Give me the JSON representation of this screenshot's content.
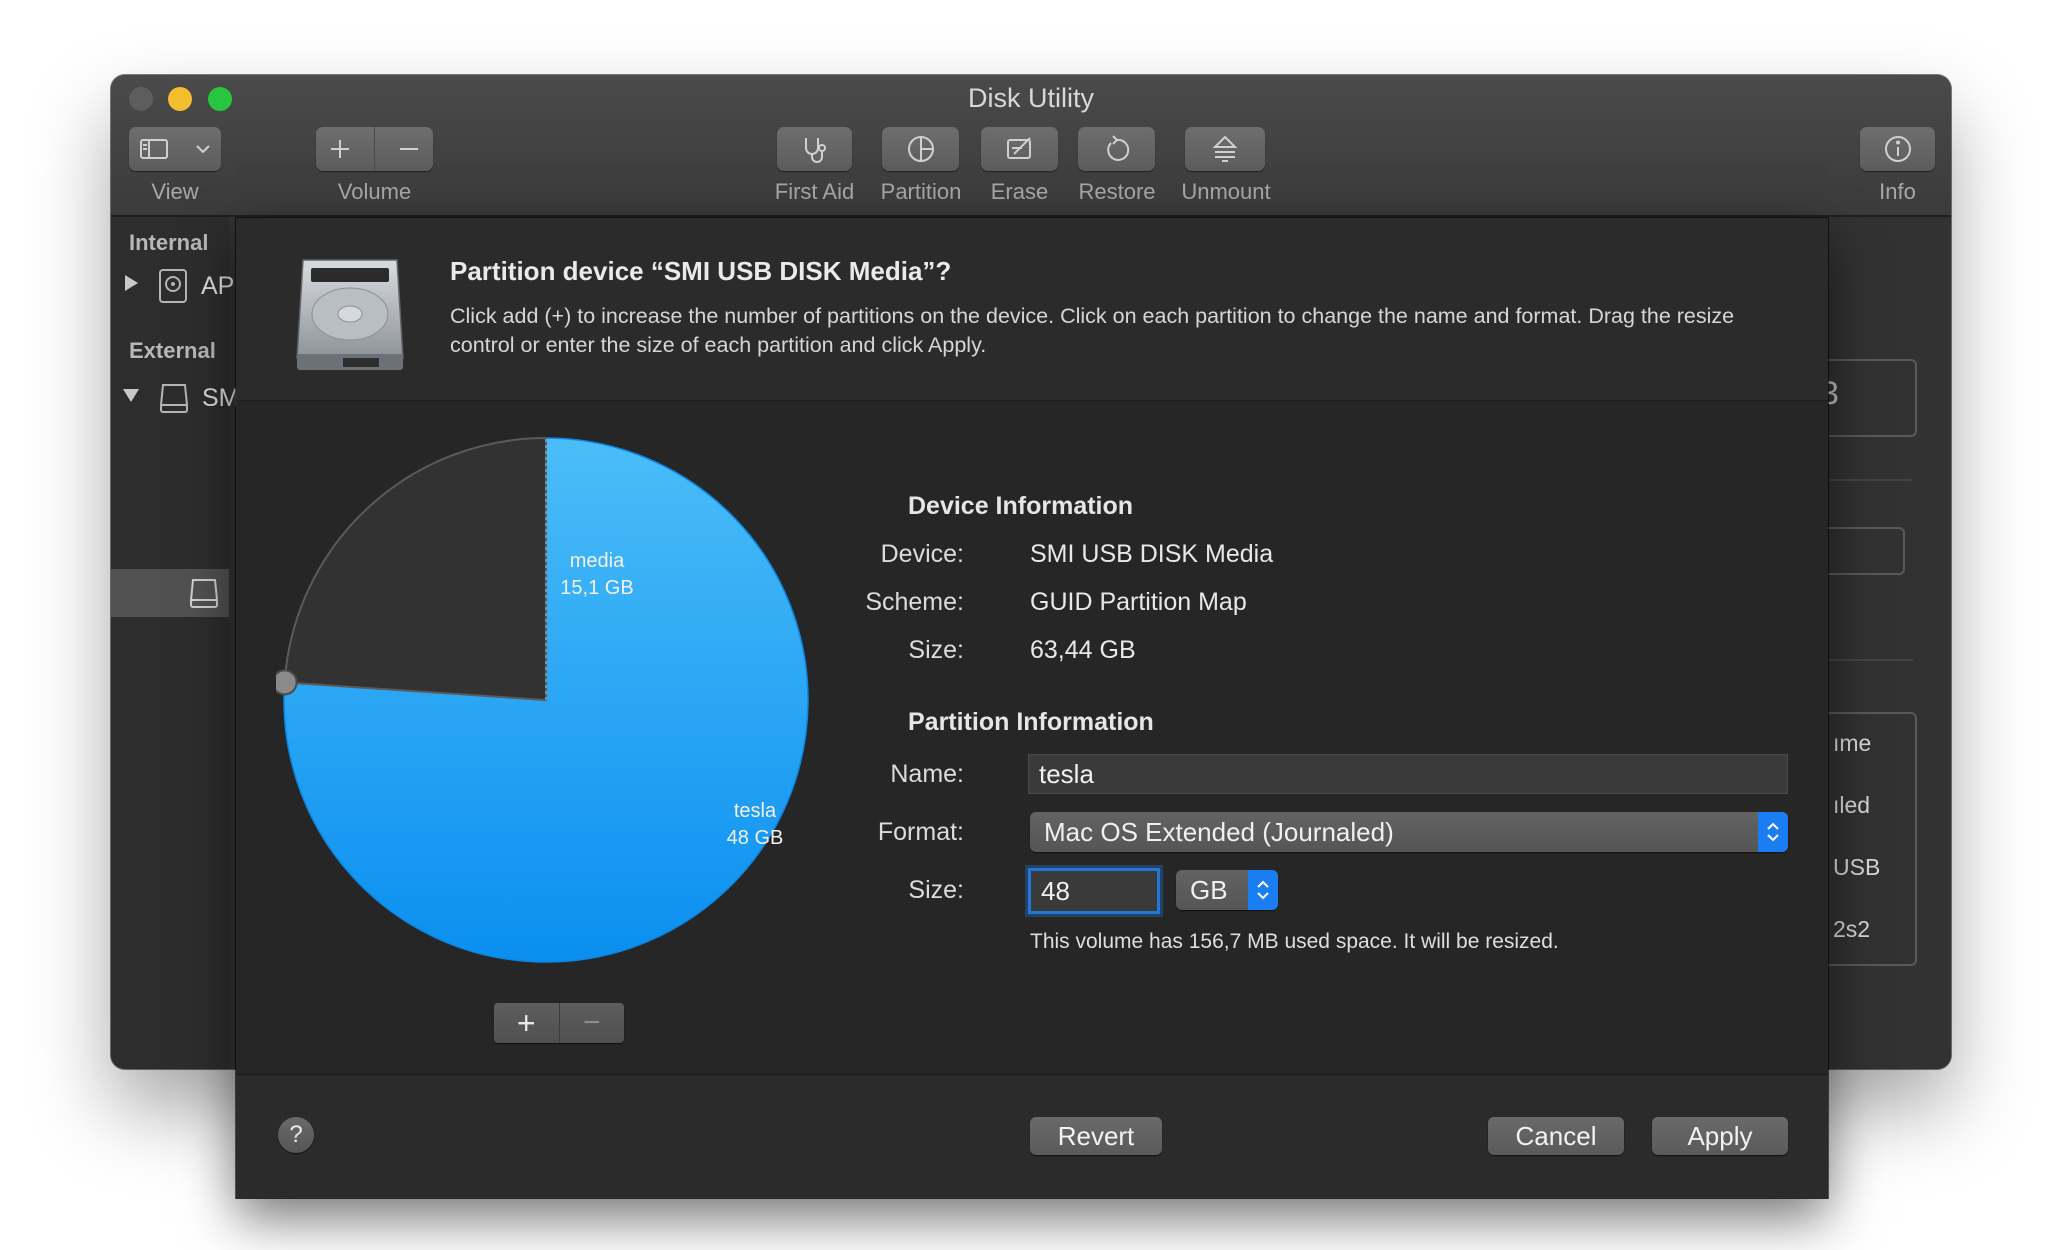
{
  "window": {
    "title": "Disk Utility"
  },
  "toolbar": {
    "view_label": "View",
    "volume_label": "Volume",
    "first_aid_label": "First Aid",
    "partition_label": "Partition",
    "erase_label": "Erase",
    "restore_label": "Restore",
    "unmount_label": "Unmount",
    "info_label": "Info"
  },
  "sidebar": {
    "internal_header": "Internal",
    "internal_items": [
      {
        "label": "AP"
      }
    ],
    "external_header": "External",
    "external_items": [
      {
        "label": "SM"
      }
    ]
  },
  "background_panel": {
    "capacity_fragment": "3",
    "rows": [
      "ıme",
      "ıled",
      "USB",
      "2s2"
    ]
  },
  "dialog": {
    "title": "Partition device “SMI USB DISK Media”?",
    "description": "Click add (+) to increase the number of partitions on the device. Click on each partition to change the name and format. Drag the resize control or enter the size of each partition and click Apply.",
    "device_info": {
      "heading": "Device Information",
      "device_label": "Device:",
      "device_value": "SMI USB DISK Media",
      "scheme_label": "Scheme:",
      "scheme_value": "GUID Partition Map",
      "size_label": "Size:",
      "size_value": "63,44 GB"
    },
    "partition_info": {
      "heading": "Partition Information",
      "name_label": "Name:",
      "name_value": "tesla",
      "format_label": "Format:",
      "format_value": "Mac OS Extended (Journaled)",
      "size_label": "Size:",
      "size_value": "48",
      "unit_value": "GB",
      "note": "This volume has 156,7 MB used space. It will be resized."
    },
    "buttons": {
      "help": "?",
      "revert": "Revert",
      "cancel": "Cancel",
      "apply": "Apply",
      "add": "+",
      "remove": "−"
    }
  },
  "chart_data": {
    "type": "pie",
    "slices": [
      {
        "name": "media",
        "label": "15,1 GB",
        "value": 15.1,
        "color": "#323232"
      },
      {
        "name": "tesla",
        "label": "48 GB",
        "value": 48,
        "color": "#12a4f5"
      }
    ]
  },
  "colors": {
    "accent": "#1a7ef2",
    "pie_blue_light": "#4bbdf8",
    "pie_blue_dark": "#0a8ff0",
    "pie_dark": "#323232"
  }
}
